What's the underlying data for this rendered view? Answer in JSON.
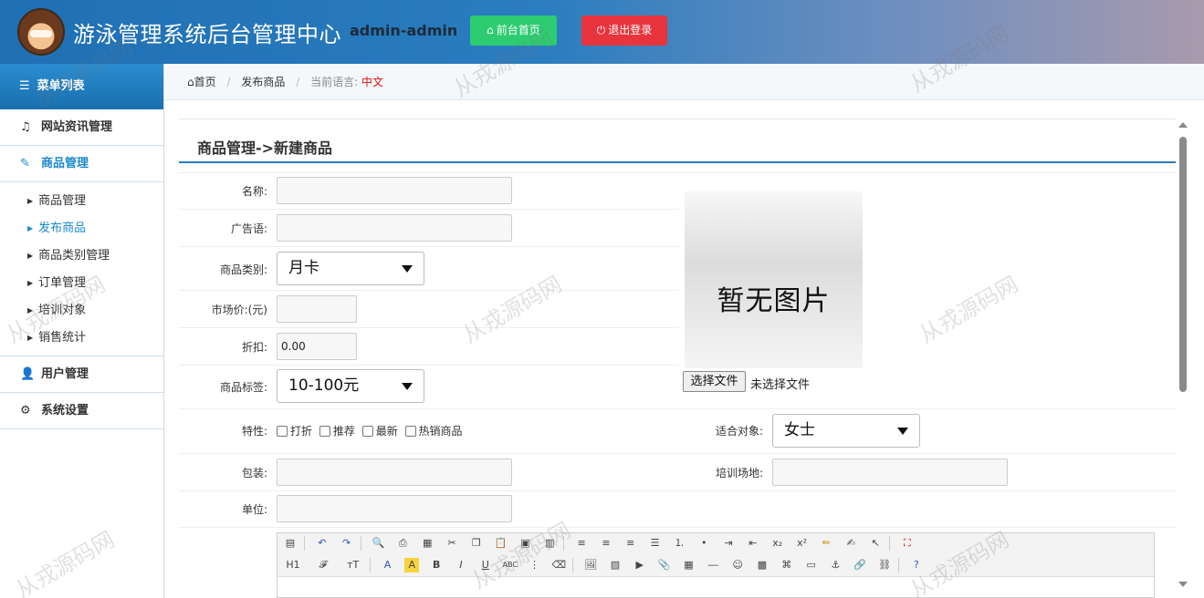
{
  "header": {
    "title": "游泳管理系统后台管理中心",
    "user": "admin-admin",
    "front_button": "前台首页",
    "logout_button": "退出登录"
  },
  "sidebar": {
    "heading": "菜单列表",
    "groups": [
      {
        "label": "网站资讯管理",
        "icon": "music-icon"
      },
      {
        "label": "商品管理",
        "icon": "edit-icon"
      },
      {
        "label": "用户管理",
        "icon": "user-icon"
      },
      {
        "label": "系统设置",
        "icon": "gear-icon"
      }
    ],
    "sub_items": [
      "商品管理",
      "发布商品",
      "商品类别管理",
      "订单管理",
      "培训对象",
      "销售统计"
    ]
  },
  "breadcrumb": {
    "home": "首页",
    "current": "发布商品",
    "lang_label": "当前语言:",
    "lang_value": "中文"
  },
  "panel": {
    "title": "商品管理->新建商品"
  },
  "form": {
    "name_label": "名称:",
    "name_value": "",
    "ad_label": "广告语:",
    "ad_value": "",
    "category_label": "商品类别:",
    "category_value": "月卡",
    "price_label": "市场价:(元)",
    "price_value": "",
    "discount_label": "折扣:",
    "discount_value": "0.00",
    "tag_label": "商品标签:",
    "tag_value": "10-100元",
    "feature_label": "特性:",
    "features": [
      "打折",
      "推荐",
      "最新",
      "热销商品"
    ],
    "target_label": "适合对象:",
    "target_value": "女士",
    "package_label": "包装:",
    "package_value": "",
    "venue_label": "培训场地:",
    "venue_value": "",
    "unit_label": "单位:",
    "unit_value": ""
  },
  "image": {
    "placeholder_text": "暂无图片",
    "file_button": "选择文件",
    "file_status": "未选择文件"
  },
  "editor": {
    "heading_tool": "H1",
    "font_tool": "𝓕",
    "size_tool": "тT"
  },
  "watermark": "从戎源码网"
}
